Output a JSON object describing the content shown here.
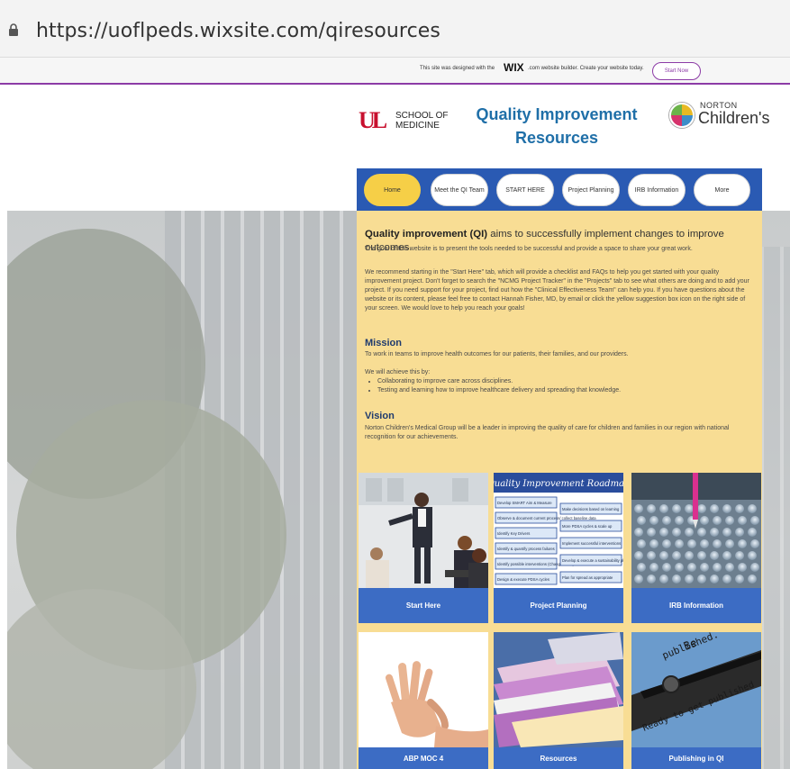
{
  "browser": {
    "url": "https://uoflpeds.wixsite.com/qiresources"
  },
  "wix_banner": {
    "text_before": "This site was designed with the",
    "brand": "WIX",
    "text_after": ".com website builder. Create your website today.",
    "start_now": "Start Now"
  },
  "header": {
    "ul_mark": "UL",
    "school_line1": "SCHOOL OF",
    "school_line2": "MEDICINE",
    "title_line1": "Quality Improvement",
    "title_line2": "Resources",
    "norton_small": "NORTON",
    "norton_big": "Children's"
  },
  "nav": {
    "items": [
      {
        "label": "Home",
        "active": true
      },
      {
        "label": "Meet the QI Team"
      },
      {
        "label": "START HERE"
      },
      {
        "label": "Project Planning"
      },
      {
        "label": "IRB Information"
      },
      {
        "label": "More"
      }
    ]
  },
  "content": {
    "lead_bold": "Quality improvement (QI)",
    "lead_rest": " aims to successfully implement changes to improve outcomes.",
    "goal": "The goal of this website is to present the tools needed to be successful and provide a space to share your great work.",
    "recommend": "We recommend starting in the \"Start Here\" tab, which will provide a checklist and FAQs to help you get started with your quality improvement project. Don't forget to search the \"NCMG Project Tracker\" in the \"Projects\" tab to see what others are doing and to add your project. If you need support for your project, find out how the \"Clinical Effectiveness Team\" can help you. If you have questions about the website or its content, please feel free to contact Hannah Fisher, MD, by email or click the yellow suggestion box icon on the right side of your screen. We would love to help you reach your goals!",
    "mission_heading": "Mission",
    "mission_text": "To work in teams to improve health outcomes for our patients, their families, and our providers.",
    "achieve_intro": "We will achieve this by:",
    "achieve_items": [
      "Collaborating to improve care across disciplines.",
      "Testing and learning how to improve healthcare delivery and spreading that knowledge."
    ],
    "vision_heading": "Vision",
    "vision_text": "Norton Children's Medical Group will be a leader in improving the quality of care for children and families in our region with national recognition for our achievements."
  },
  "roadmap": {
    "title": "Quality Improvement Roadmap",
    "left_steps": [
      "Develop SMART Aim & Measure",
      "Observe & document current process/ collect baseline data",
      "Identify Key Drivers",
      "Identify & quantify process failures",
      "Identify possible interventions (Change Ideas)",
      "Design & execute PDSA cycles"
    ],
    "right_steps": [
      "Make decisions based on learning",
      "More PDSA cycles & scale up",
      "Implement successful interventions",
      "Develop & execute a sustainability plan",
      "Plan for spread as appropriate"
    ]
  },
  "cards": [
    {
      "label": "Start Here"
    },
    {
      "label": "Project Planning"
    },
    {
      "label": "IRB Information"
    },
    {
      "label": "ABP MOC 4"
    },
    {
      "label": "Resources"
    },
    {
      "label": "Publishing in QI"
    }
  ],
  "typewriter_texts": [
    "Be",
    "published.",
    "Ready to get published"
  ],
  "colors": {
    "nav_bg": "#2a5ab3",
    "active_nav": "#f6cf47",
    "panel_bg": "#f8dd94",
    "card_label_bg": "#3c6cc4",
    "title_blue": "#1f6fa8",
    "wix_purple": "#8c3ba6"
  }
}
